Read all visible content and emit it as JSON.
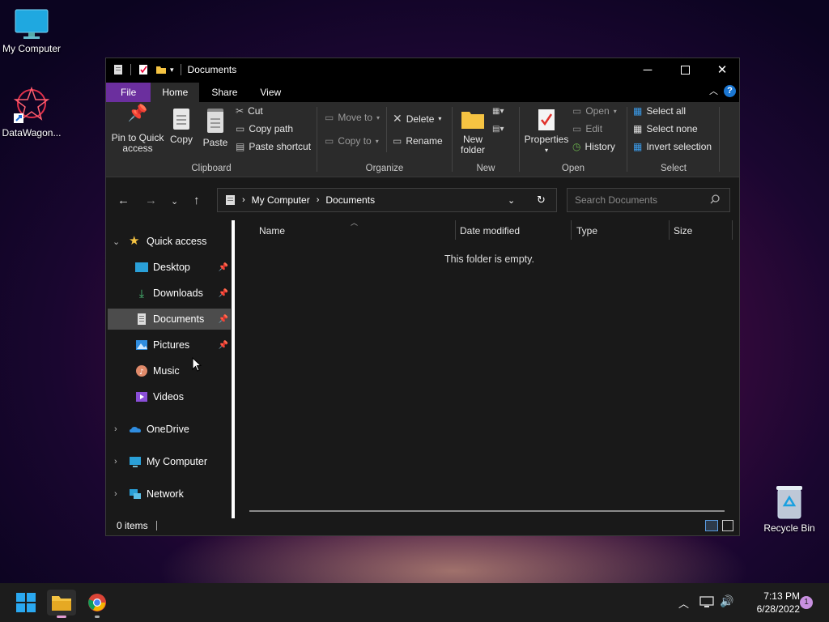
{
  "desktop": {
    "icons": [
      {
        "label": "My Computer",
        "icon": "monitor-icon"
      },
      {
        "label": "DataWagon...",
        "icon": "datawagon-icon"
      },
      {
        "label": "Recycle Bin",
        "icon": "recycle-bin-icon"
      }
    ]
  },
  "window": {
    "title": "Documents",
    "controls": {
      "minimize": "minimize-icon",
      "maximize": "maximize-icon",
      "close": "close-icon"
    }
  },
  "ribbon": {
    "tabs": [
      "File",
      "Home",
      "Share",
      "View"
    ],
    "active_tab": "Home",
    "help": "?",
    "clipboard": {
      "label": "Clipboard",
      "pin_line1": "Pin to Quick",
      "pin_line2": "access",
      "copy": "Copy",
      "paste": "Paste",
      "cut": "Cut",
      "copy_path": "Copy path",
      "paste_shortcut": "Paste shortcut"
    },
    "organize": {
      "label": "Organize",
      "move_to": "Move to",
      "copy_to": "Copy to",
      "delete": "Delete",
      "rename": "Rename"
    },
    "new": {
      "label": "New",
      "new_folder_line1": "New",
      "new_folder_line2": "folder"
    },
    "open": {
      "label": "Open",
      "properties": "Properties",
      "open": "Open",
      "edit": "Edit",
      "history": "History"
    },
    "select": {
      "label": "Select",
      "select_all": "Select all",
      "select_none": "Select none",
      "invert": "Invert selection"
    }
  },
  "address": {
    "crumbs": [
      "My Computer",
      "Documents"
    ],
    "search_placeholder": "Search Documents"
  },
  "nav": {
    "quick_access": "Quick access",
    "items": [
      {
        "label": "Desktop",
        "pinned": true
      },
      {
        "label": "Downloads",
        "pinned": true
      },
      {
        "label": "Documents",
        "pinned": true,
        "selected": true
      },
      {
        "label": "Pictures",
        "pinned": true
      },
      {
        "label": "Music",
        "pinned": false
      },
      {
        "label": "Videos",
        "pinned": false
      }
    ],
    "onedrive": "OneDrive",
    "my_computer": "My Computer",
    "network": "Network"
  },
  "content": {
    "columns": [
      "Name",
      "Date modified",
      "Type",
      "Size"
    ],
    "empty_message": "This folder is empty."
  },
  "status": {
    "items": "0 items"
  },
  "taskbar": {
    "time": "7:13 PM",
    "date": "6/28/2022",
    "notification_count": "1"
  },
  "colors": {
    "file_tab": "#6b2f9e",
    "accent": "#1a76d2",
    "window_bg": "#191919",
    "ribbon_bg": "#2b2b2b"
  }
}
